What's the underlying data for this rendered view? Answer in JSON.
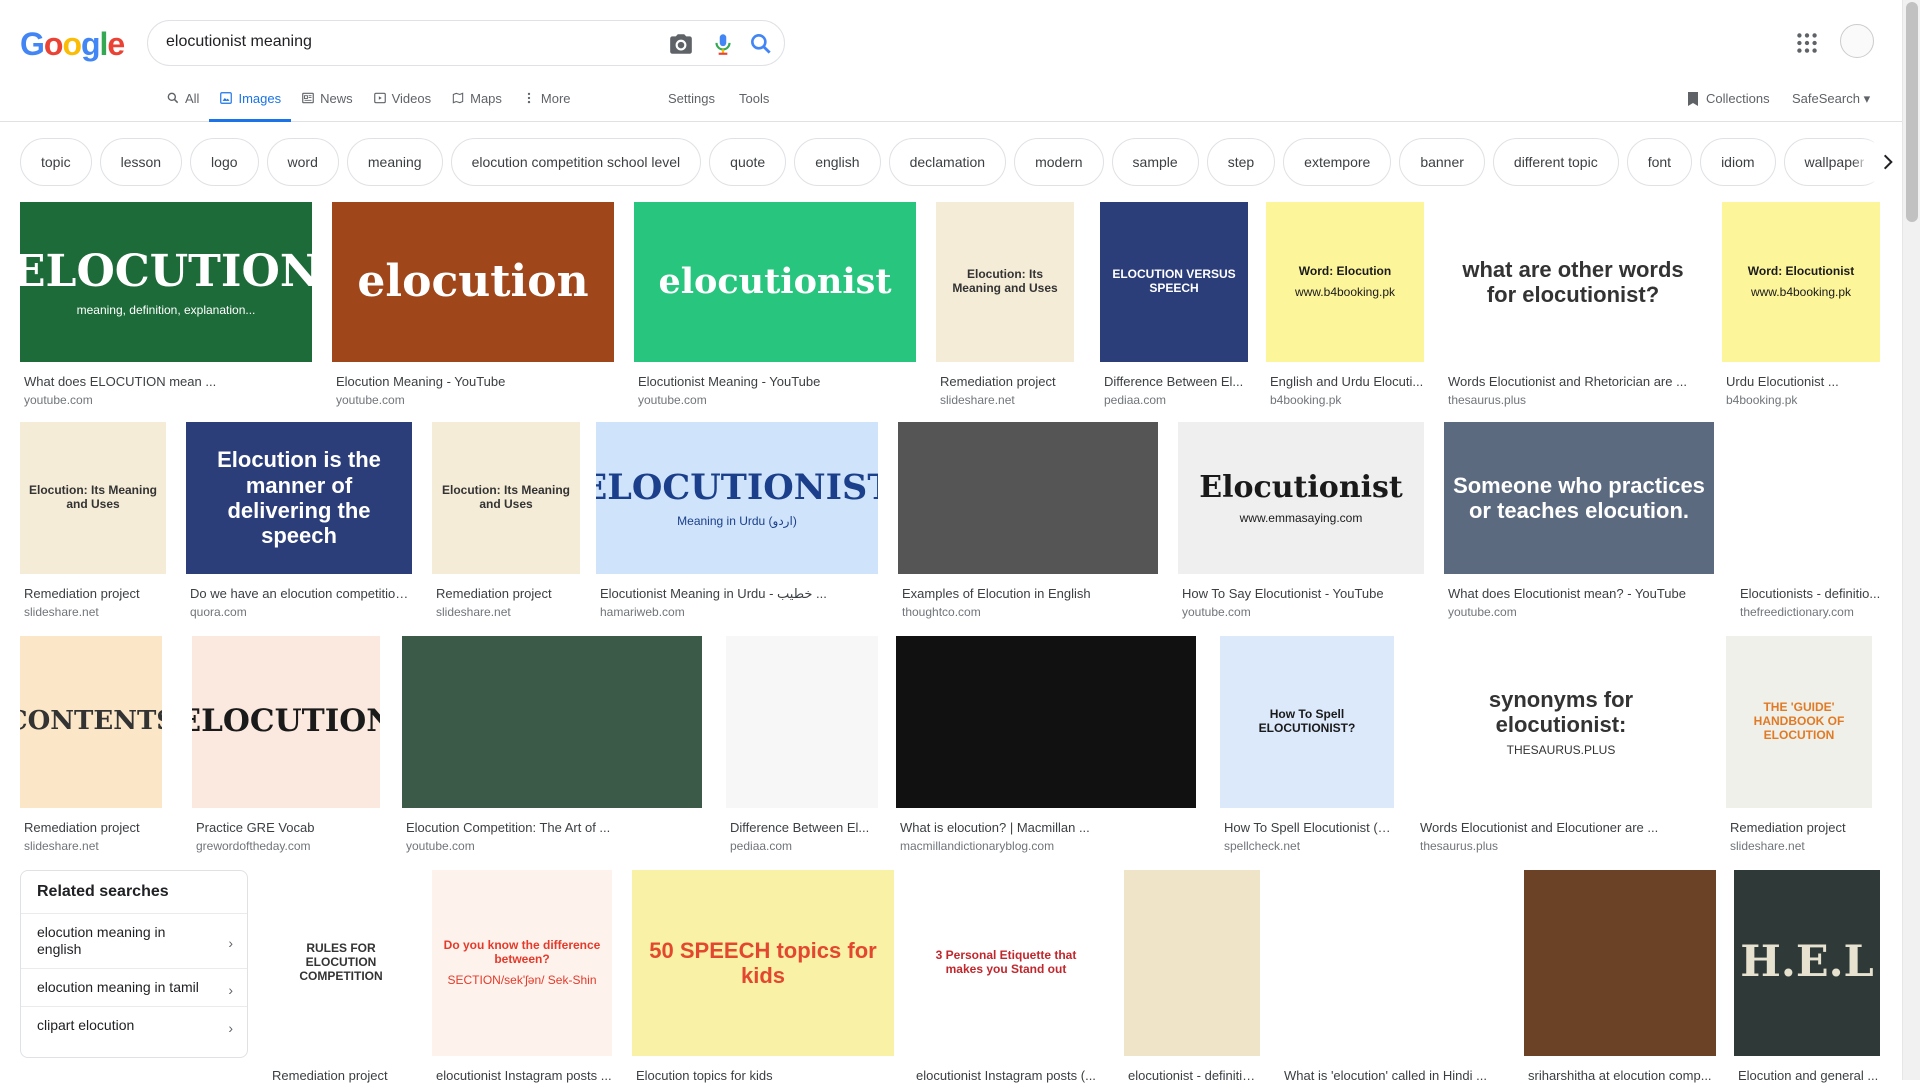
{
  "search": {
    "query": "elocutionist meaning"
  },
  "logo": [
    "G",
    "o",
    "o",
    "g",
    "l",
    "e"
  ],
  "tabs": [
    {
      "label": "All"
    },
    {
      "label": "Images"
    },
    {
      "label": "News"
    },
    {
      "label": "Videos"
    },
    {
      "label": "Maps"
    },
    {
      "label": "More"
    }
  ],
  "tools": {
    "settings": "Settings",
    "tools": "Tools",
    "collections": "Collections",
    "safesearch": "SafeSearch"
  },
  "chips": [
    "topic",
    "lesson",
    "logo",
    "word",
    "meaning",
    "elocution competition school level",
    "quote",
    "english",
    "declamation",
    "modern",
    "sample",
    "step",
    "extempore",
    "banner",
    "different topic",
    "font",
    "idiom",
    "wallpaper"
  ],
  "images": [
    {
      "caption": "What does ELOCUTION mean ...",
      "source": "youtube.com",
      "thumb_text": "ELOCUTION",
      "thumb_sub": "meaning, definition, explanation...",
      "bg": "#1e6b3a",
      "fg": "#ffffff"
    },
    {
      "caption": "Elocution Meaning - YouTube",
      "source": "youtube.com",
      "thumb_text": "elocution",
      "thumb_sub": "",
      "bg": "#a0461b",
      "fg": "#ffffff"
    },
    {
      "caption": "Elocutionist Meaning - YouTube",
      "source": "youtube.com",
      "thumb_text": "elocutionist",
      "thumb_sub": "",
      "bg": "#27c57e",
      "fg": "#ffffff"
    },
    {
      "caption": "Remediation project",
      "source": "slideshare.net",
      "thumb_text": "Elocution: Its Meaning and Uses",
      "thumb_sub": "",
      "bg": "#f5ecd8",
      "fg": "#333333"
    },
    {
      "caption": "Difference Between El...",
      "source": "pediaa.com",
      "thumb_text": "ELOCUTION VERSUS SPEECH",
      "thumb_sub": "",
      "bg": "#2c3e7a",
      "fg": "#ffffff"
    },
    {
      "caption": "English and Urdu Elocuti...",
      "source": "b4booking.pk",
      "thumb_text": "Word: Elocution",
      "thumb_sub": "www.b4booking.pk",
      "bg": "#fdf59a",
      "fg": "#1a1a1a"
    },
    {
      "caption": "Words Elocutionist and Rhetorician are ...",
      "source": "thesaurus.plus",
      "thumb_text": "what are other words for elocutionist?",
      "thumb_sub": "",
      "bg": "#ffffff",
      "fg": "#333333"
    },
    {
      "caption": "Urdu Elocutionist ...",
      "source": "b4booking.pk",
      "thumb_text": "Word: Elocutionist",
      "thumb_sub": "www.b4booking.pk",
      "bg": "#fdf59a",
      "fg": "#1a1a1a"
    },
    {
      "caption": "Remediation project",
      "source": "slideshare.net",
      "thumb_text": "Elocution: Its Meaning and Uses",
      "thumb_sub": "",
      "bg": "#f5ecd8",
      "fg": "#333333"
    },
    {
      "caption": "Do we have an elocution competition...",
      "source": "quora.com",
      "thumb_text": "Elocution is the manner of delivering the speech",
      "thumb_sub": "",
      "bg": "#2c3e7a",
      "fg": "#ffffff"
    },
    {
      "caption": "Remediation project",
      "source": "slideshare.net",
      "thumb_text": "Elocution: Its Meaning and Uses",
      "thumb_sub": "",
      "bg": "#f5ecd8",
      "fg": "#333333"
    },
    {
      "caption": "Elocutionist Meaning in Urdu - خطیب ...",
      "source": "hamariweb.com",
      "thumb_text": "ELOCUTIONIST",
      "thumb_sub": "Meaning in Urdu (اردو)",
      "bg": "#cfe3fb",
      "fg": "#1b3f8a"
    },
    {
      "caption": "Examples of Elocution in English",
      "source": "thoughtco.com",
      "thumb_text": "",
      "thumb_sub": "",
      "bg": "#555555",
      "fg": "#ffffff"
    },
    {
      "caption": "How To Say Elocutionist - YouTube",
      "source": "youtube.com",
      "thumb_text": "Elocutionist",
      "thumb_sub": "www.emmasaying.com",
      "bg": "#efefef",
      "fg": "#1a1a1a"
    },
    {
      "caption": "What does Elocutionist mean? - YouTube",
      "source": "youtube.com",
      "thumb_text": "Someone who practices or teaches elocution.",
      "thumb_sub": "",
      "bg": "#5c6a80",
      "fg": "#ffffff"
    },
    {
      "caption": "Elocutionists - definitio...",
      "source": "thefreedictionary.com",
      "thumb_text": "",
      "thumb_sub": "",
      "bg": "#ffffff",
      "fg": "#1a1a1a"
    },
    {
      "caption": "Remediation project",
      "source": "slideshare.net",
      "thumb_text": "CONTENTS",
      "thumb_sub": "",
      "bg": "#fbe6c8",
      "fg": "#333333"
    },
    {
      "caption": "Practice GRE Vocab",
      "source": "grewordoftheday.com",
      "thumb_text": "ELOCUTION",
      "thumb_sub": "",
      "bg": "#fbe9df",
      "fg": "#1a1a1a"
    },
    {
      "caption": "Elocution Competition: The Art of ...",
      "source": "youtube.com",
      "thumb_text": "",
      "thumb_sub": "",
      "bg": "#3b5a48",
      "fg": "#ffffff"
    },
    {
      "caption": "Difference Between El...",
      "source": "pediaa.com",
      "thumb_text": "",
      "thumb_sub": "",
      "bg": "#f7f7f7",
      "fg": "#333333"
    },
    {
      "caption": "What is elocution? | Macmillan ...",
      "source": "macmillandictionaryblog.com",
      "thumb_text": "",
      "thumb_sub": "",
      "bg": "#111111",
      "fg": "#ffffff"
    },
    {
      "caption": "How To Spell Elocutionist (A...",
      "source": "spellcheck.net",
      "thumb_text": "How To Spell ELOCUTIONIST?",
      "thumb_sub": "",
      "bg": "#dbe9fb",
      "fg": "#1a1a1a"
    },
    {
      "caption": "Words Elocutionist and Elocutioner are ...",
      "source": "thesaurus.plus",
      "thumb_text": "synonyms for elocutionist:",
      "thumb_sub": "THESAURUS.PLUS",
      "bg": "#ffffff",
      "fg": "#333333"
    },
    {
      "caption": "Remediation project",
      "source": "slideshare.net",
      "thumb_text": "THE 'GUIDE' HANDBOOK OF ELOCUTION",
      "thumb_sub": "",
      "bg": "#f0f0ea",
      "fg": "#e07a25"
    },
    {
      "caption": "Remediation project",
      "source": "",
      "thumb_text": "RULES FOR ELOCUTION COMPETITION",
      "thumb_sub": "",
      "bg": "#ffffff",
      "fg": "#333333"
    },
    {
      "caption": "elocutionist Instagram posts ...",
      "source": "",
      "thumb_text": "Do you know the difference between?",
      "thumb_sub": "SECTION/sek'ʃən/ Sek-Shin",
      "bg": "#fdf3ec",
      "fg": "#e33a2b"
    },
    {
      "caption": "Elocution topics for kids",
      "source": "",
      "thumb_text": "50 SPEECH topics for kids",
      "thumb_sub": "",
      "bg": "#f8f1a6",
      "fg": "#e4472f"
    },
    {
      "caption": "elocutionist Instagram posts (...",
      "source": "",
      "thumb_text": "3 Personal Etiquette that makes you Stand out",
      "thumb_sub": "",
      "bg": "#ffffff",
      "fg": "#c0272d"
    },
    {
      "caption": "elocutionist - definition...",
      "source": "",
      "thumb_text": "",
      "thumb_sub": "",
      "bg": "#efe3c8",
      "fg": "#333333"
    },
    {
      "caption": "What is 'elocution' called in Hindi ...",
      "source": "",
      "thumb_text": "",
      "thumb_sub": "",
      "bg": "#ffffff",
      "fg": "#333333"
    },
    {
      "caption": "sriharshitha at elocution comp...",
      "source": "",
      "thumb_text": "",
      "thumb_sub": "",
      "bg": "#6b4226",
      "fg": "#ffffff"
    },
    {
      "caption": "Elocution and general ...",
      "source": "",
      "thumb_text": "H.E.L",
      "thumb_sub": "",
      "bg": "#2f3a38",
      "fg": "#e6e2cf"
    }
  ],
  "related": {
    "title": "Related searches",
    "items": [
      "elocution meaning in english",
      "elocution meaning in tamil",
      "clipart elocution"
    ]
  }
}
